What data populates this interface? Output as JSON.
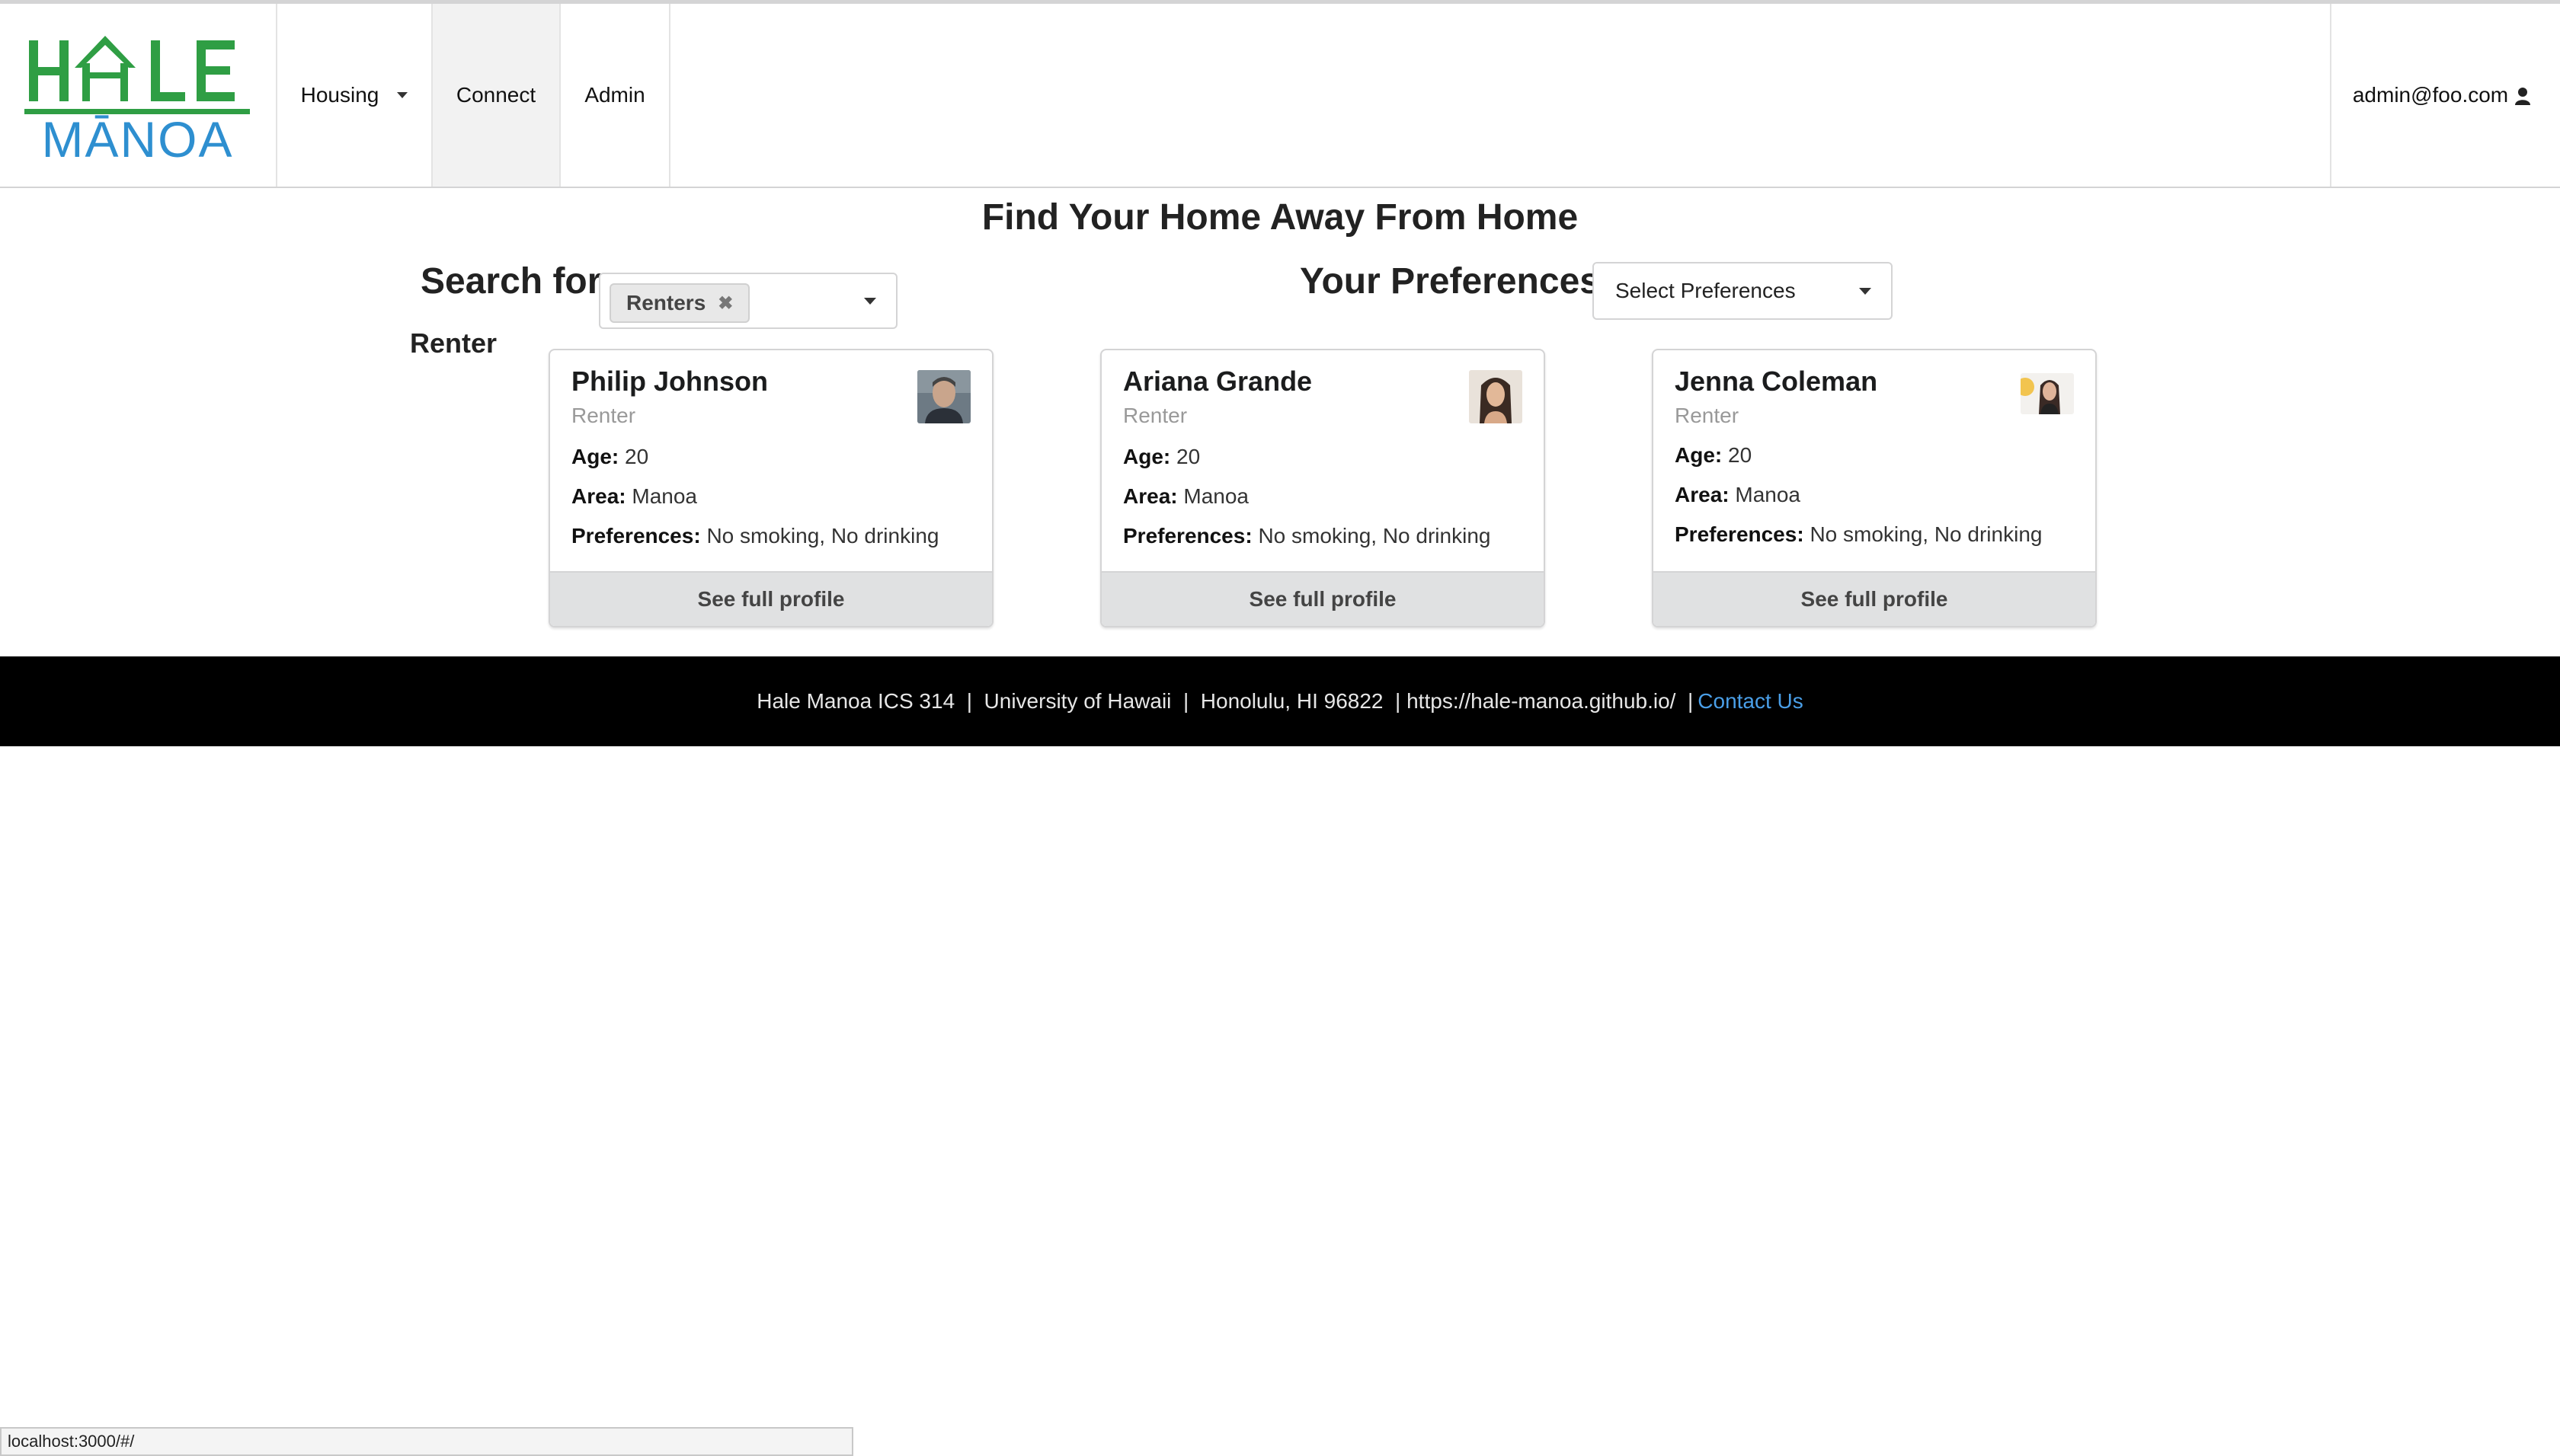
{
  "nav": {
    "logo_top": "HALE",
    "logo_bottom": "MĀNOA",
    "housing": "Housing",
    "connect": "Connect",
    "admin": "Admin",
    "user": "admin@foo.com",
    "active_tab": "Connect"
  },
  "page": {
    "title": "Find Your Home Away From Home",
    "search_label": "Search for:",
    "search_chip": "Renters",
    "preferences_label": "Your Preferences:",
    "preferences_placeholder": "Select Preferences",
    "section_label": "Renter"
  },
  "labels": {
    "age": "Age:",
    "area": "Area:",
    "preferences": "Preferences:",
    "button": "See full profile"
  },
  "cards": [
    {
      "name": "Philip Johnson",
      "role": "Renter",
      "age": "20",
      "area": "Manoa",
      "preferences": "No smoking, No drinking",
      "avatar": "philip-avatar"
    },
    {
      "name": "Ariana Grande",
      "role": "Renter",
      "age": "20",
      "area": "Manoa",
      "preferences": "No smoking, No drinking",
      "avatar": "ariana-avatar"
    },
    {
      "name": "Jenna Coleman",
      "role": "Renter",
      "age": "20",
      "area": "Manoa",
      "preferences": "No smoking, No drinking",
      "avatar": "jenna-avatar"
    }
  ],
  "footer": {
    "text": "Hale Manoa ICS 314  |  University of Hawaii  |  Honolulu, HI 96822  | https://hale-manoa.github.io/  |",
    "contact": "Contact Us"
  },
  "status_bar": "localhost:3000/#/",
  "colors": {
    "logo_green": "#2f9e44",
    "logo_blue": "#2e8fd0",
    "link": "#4a9fe8",
    "footer_bg": "#000000"
  }
}
